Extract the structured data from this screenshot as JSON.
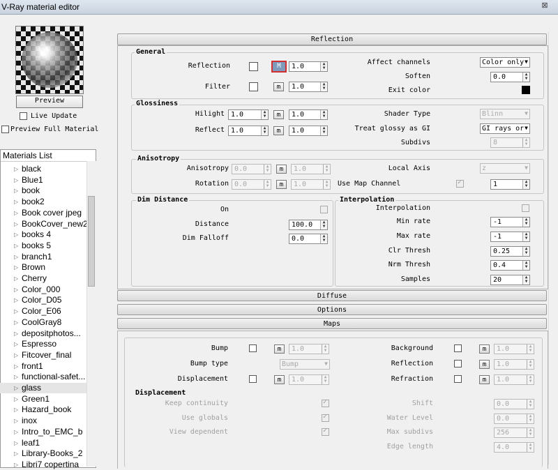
{
  "window": {
    "title": "V-Ray material editor",
    "close_glyph": "⊠"
  },
  "preview": {
    "button": "Preview",
    "live_update": "Live Update",
    "full_material": "Preview Full Material"
  },
  "materials": {
    "header": "Materials List",
    "items": [
      "black",
      "Blue1",
      "book",
      "book2",
      "Book cover jpeg",
      "BookCover_new2",
      "books 4",
      "books 5",
      "branch1",
      "Brown",
      "Cherry",
      "Color_000",
      "Color_D05",
      "Color_E06",
      "CoolGray8",
      "depositphotos...",
      "Espresso",
      "Fitcover_final",
      "front1",
      "functional-safet...",
      "glass",
      "Green1",
      "Hazard_book",
      "inox",
      "Intro_to_EMC_b",
      "leaf1",
      "Library-Books_2",
      "Libri7 copertina"
    ],
    "selected": "glass"
  },
  "reflection": {
    "rollout": "Reflection",
    "general": {
      "title": "General",
      "reflection_label": "Reflection",
      "reflection_value": "1.0",
      "reflection_m": "M",
      "filter_label": "Filter",
      "filter_value": "1.0",
      "filter_m": "m",
      "affect_channels_label": "Affect channels",
      "affect_channels_value": "Color only",
      "soften_label": "Soften",
      "soften_value": "0.0",
      "exit_color_label": "Exit color",
      "exit_color": "#000000"
    },
    "glossiness": {
      "title": "Glossiness",
      "hilight_label": "Hilight",
      "hilight_value": "1.0",
      "hilight_m_value": "1.0",
      "reflect_label": "Reflect",
      "reflect_value": "1.0",
      "reflect_m_value": "1.0",
      "m": "m",
      "shader_type_label": "Shader Type",
      "shader_type_value": "Blinn",
      "treat_glossy_label": "Treat glossy as GI",
      "treat_glossy_value": "GI rays or",
      "subdivs_label": "Subdivs",
      "subdivs_value": "8"
    },
    "anisotropy": {
      "title": "Anisotropy",
      "anisotropy_label": "Anisotropy",
      "anisotropy_value": "0.0",
      "anisotropy_m_value": "1.0",
      "rotation_label": "Rotation",
      "rotation_value": "0.0",
      "rotation_m_value": "1.0",
      "m": "m",
      "local_axis_label": "Local Axis",
      "local_axis_value": "z",
      "use_map_channel_label": "Use Map Channel",
      "use_map_channel_value": "1"
    },
    "dim_distance": {
      "title": "Dim Distance",
      "on_label": "On",
      "distance_label": "Distance",
      "distance_value": "100.0",
      "dim_falloff_label": "Dim Falloff",
      "dim_falloff_value": "0.0"
    },
    "interpolation": {
      "title": "Interpolation",
      "interpolation_label": "Interpolation",
      "min_rate_label": "Min rate",
      "min_rate_value": "-1",
      "max_rate_label": "Max rate",
      "max_rate_value": "-1",
      "clr_thresh_label": "Clr Thresh",
      "clr_thresh_value": "0.25",
      "nrm_thresh_label": "Nrm Thresh",
      "nrm_thresh_value": "0.4",
      "samples_label": "Samples",
      "samples_value": "20"
    }
  },
  "rollouts": {
    "diffuse": "Diffuse",
    "options": "Options",
    "maps": "Maps"
  },
  "maps": {
    "bump_label": "Bump",
    "bump_value": "1.0",
    "bump_type_label": "Bump type",
    "bump_type_value": "Bump",
    "displacement_label": "Displacement",
    "displacement_value": "1.0",
    "background_label": "Background",
    "background_value": "1.0",
    "reflection_label": "Reflection",
    "reflection_value": "1.0",
    "refraction_label": "Refraction",
    "refraction_value": "1.0",
    "m": "m",
    "displacement_group": {
      "title": "Displacement",
      "keep_continuity": "Keep continuity",
      "use_globals": "Use globals",
      "view_dependent": "View dependent",
      "shift_label": "Shift",
      "shift_value": "0.0",
      "water_level_label": "Water Level",
      "water_level_value": "0.0",
      "max_subdivs_label": "Max subdivs",
      "max_subdivs_value": "256",
      "edge_length_label": "Edge length",
      "edge_length_value": "4.0"
    }
  }
}
